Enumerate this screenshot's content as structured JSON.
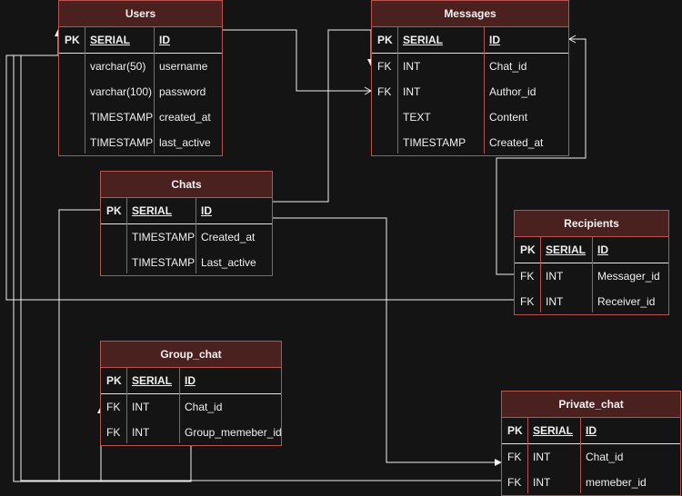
{
  "tables": [
    {
      "key": "users",
      "name": "Users",
      "rows": [
        {
          "key": "PK",
          "type": "SERIAL",
          "field": "ID",
          "pk": true
        },
        {
          "key": "",
          "type": "varchar(50)",
          "field": "username"
        },
        {
          "key": "",
          "type": "varchar(100)",
          "field": "password"
        },
        {
          "key": "",
          "type": "TIMESTAMP",
          "field": "created_at"
        },
        {
          "key": "",
          "type": "TIMESTAMP",
          "field": "last_active"
        }
      ]
    },
    {
      "key": "messages",
      "name": "Messages",
      "rows": [
        {
          "key": "PK",
          "type": "SERIAL",
          "field": "ID",
          "pk": true
        },
        {
          "key": "FK",
          "type": "INT",
          "field": "Chat_id"
        },
        {
          "key": "FK",
          "type": "INT",
          "field": "Author_id"
        },
        {
          "key": "",
          "type": "TEXT",
          "field": "Content"
        },
        {
          "key": "",
          "type": "TIMESTAMP",
          "field": "Created_at"
        }
      ]
    },
    {
      "key": "chats",
      "name": "Chats",
      "rows": [
        {
          "key": "PK",
          "type": "SERIAL",
          "field": "ID",
          "pk": true
        },
        {
          "key": "",
          "type": "TIMESTAMP",
          "field": "Created_at"
        },
        {
          "key": "",
          "type": "TIMESTAMP",
          "field": "Last_active"
        }
      ]
    },
    {
      "key": "recipients",
      "name": "Recipients",
      "rows": [
        {
          "key": "PK",
          "type": "SERIAL",
          "field": "ID",
          "pk": true
        },
        {
          "key": "FK",
          "type": "INT",
          "field": "Messager_id"
        },
        {
          "key": "FK",
          "type": "INT",
          "field": "Receiver_id"
        }
      ]
    },
    {
      "key": "group-chat",
      "name": "Group_chat",
      "rows": [
        {
          "key": "PK",
          "type": "SERIAL",
          "field": "ID",
          "pk": true
        },
        {
          "key": "FK",
          "type": "INT",
          "field": "Chat_id"
        },
        {
          "key": "FK",
          "type": "INT",
          "field": "Group_memeber_id"
        }
      ]
    },
    {
      "key": "private-chat",
      "name": "Private_chat",
      "rows": [
        {
          "key": "PK",
          "type": "SERIAL",
          "field": "ID",
          "pk": true
        },
        {
          "key": "FK",
          "type": "INT",
          "field": "Chat_id"
        },
        {
          "key": "FK",
          "type": "INT",
          "field": "memeber_id"
        }
      ]
    }
  ],
  "colors": {
    "background": "#141414",
    "header_fill": "#4b2120",
    "border": "#b85450",
    "text": "#f0f0f0",
    "connector": "#f0f0f0"
  }
}
